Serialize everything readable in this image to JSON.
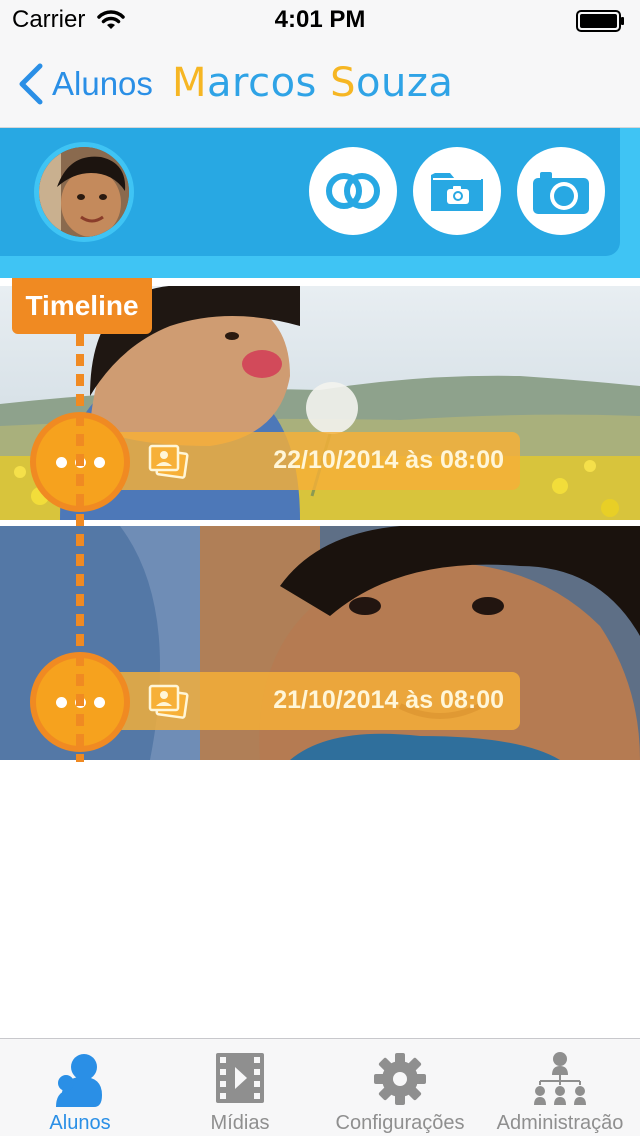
{
  "status_bar": {
    "carrier": "Carrier",
    "time": "4:01 PM"
  },
  "nav": {
    "back_label": "Alunos",
    "title_part1_initial": "M",
    "title_part1_rest": "arcos ",
    "title_part2_initial": "S",
    "title_part2_rest": "ouza"
  },
  "header": {
    "avatar": "student-avatar",
    "buttons": [
      "rings-icon",
      "folder-camera-icon",
      "camera-icon"
    ]
  },
  "timeline": {
    "tag_label": "Timeline",
    "entries": [
      {
        "date": "22/10/2014 às 08:00",
        "icon": "gallery-icon"
      },
      {
        "date": "21/10/2014 às 08:00",
        "icon": "gallery-icon"
      }
    ]
  },
  "tabs": [
    {
      "label": "Alunos",
      "icon": "students-icon",
      "active": true
    },
    {
      "label": "Mídias",
      "icon": "film-icon",
      "active": false
    },
    {
      "label": "Configurações",
      "icon": "gear-icon",
      "active": false
    },
    {
      "label": "Administração",
      "icon": "org-chart-icon",
      "active": false
    }
  ],
  "colors": {
    "accent_blue": "#2a8fe6",
    "header_blue": "#28a8e3",
    "header_light_blue": "#3fc4f4",
    "timeline_orange": "#f08a22",
    "title_yellow": "#f6b623"
  }
}
